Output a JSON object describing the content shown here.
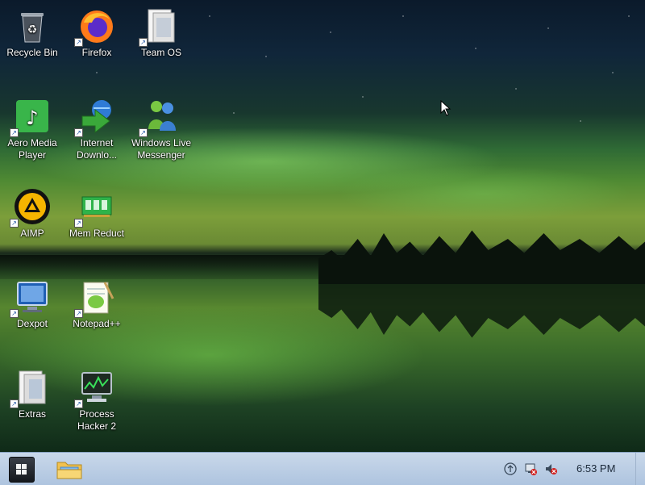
{
  "desktop": {
    "icons": [
      {
        "label": "Recycle Bin",
        "icon": "recycle-bin-icon"
      },
      {
        "label": "Firefox",
        "icon": "firefox-icon"
      },
      {
        "label": "Team OS",
        "icon": "folder-icon"
      },
      {
        "label": "Aero Media Player",
        "icon": "music-note-icon"
      },
      {
        "label": "Internet Downlo...",
        "icon": "download-globe-icon"
      },
      {
        "label": "Windows Live Messenger",
        "icon": "messenger-icon"
      },
      {
        "label": "AIMP",
        "icon": "aimp-icon"
      },
      {
        "label": "Mem Reduct",
        "icon": "memory-chip-icon"
      },
      {
        "label": "Dexpot",
        "icon": "desktop-screen-icon"
      },
      {
        "label": "Notepad++",
        "icon": "notepad-plus-icon"
      },
      {
        "label": "Extras",
        "icon": "folder-icon"
      },
      {
        "label": "Process Hacker 2",
        "icon": "process-monitor-icon"
      }
    ]
  },
  "taskbar": {
    "start_icon": "windows-logo-icon",
    "pinned": [
      {
        "icon": "file-explorer-icon"
      }
    ],
    "tray": {
      "icons": [
        "action-center-icon",
        "network-disconnected-icon",
        "volume-muted-icon"
      ],
      "clock": "6:53 PM"
    }
  },
  "colors": {
    "taskbar_top": "#c9d8ea",
    "taskbar_bottom": "#aec4df",
    "aurora_green": "#4f8a33"
  }
}
